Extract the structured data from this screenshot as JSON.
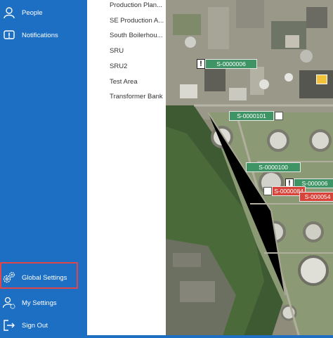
{
  "nav": {
    "top_items": [
      {
        "label": "People",
        "icon": "person-icon"
      },
      {
        "label": "Notifications",
        "icon": "notification-icon"
      }
    ],
    "bottom_items": [
      {
        "label": "Global Settings",
        "icon": "gears-icon",
        "highlighted": true
      },
      {
        "label": "My Settings",
        "icon": "user-settings-icon"
      },
      {
        "label": "Sign Out",
        "icon": "sign-out-icon"
      }
    ]
  },
  "area_list": [
    "Production Plan...",
    "SE Production A...",
    "South Boilerhou...",
    "SRU",
    "SRU2",
    "Test Area",
    "Transformer Bank"
  ],
  "map": {
    "tags": [
      {
        "id": "S-0000006",
        "color": "green",
        "warning": true
      },
      {
        "id": "S-0000101",
        "color": "green",
        "qr": true
      },
      {
        "id": "S-0000100",
        "color": "green"
      },
      {
        "id": "S-000006",
        "color": "green",
        "warning": true
      },
      {
        "id": "S-0000084",
        "color": "red",
        "qr": true
      },
      {
        "id": "S-000054",
        "color": "red"
      }
    ]
  },
  "colors": {
    "nav_bg": "#1d6fc4",
    "highlight": "#e0474c",
    "tag_green": "#3f9466",
    "tag_red": "#d9443a"
  }
}
